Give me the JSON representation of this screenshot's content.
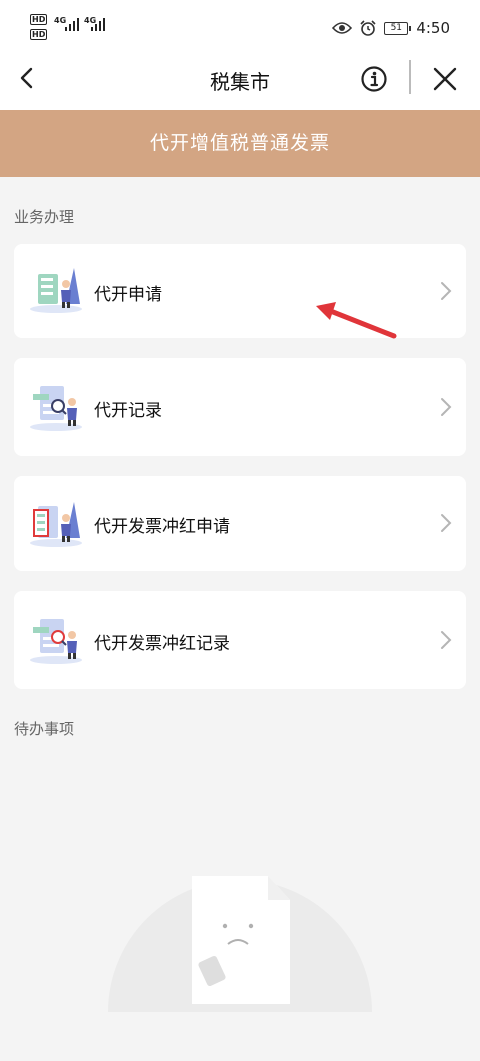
{
  "status_bar": {
    "left_indicators": [
      "HD",
      "HD",
      "4G",
      "4G"
    ],
    "battery": "51",
    "time": "4:50",
    "icons": [
      "eye-icon",
      "alarm-icon",
      "battery-icon"
    ]
  },
  "nav": {
    "title": "税集市",
    "icons": [
      "back-arrow-icon",
      "info-icon",
      "close-icon"
    ]
  },
  "banner": {
    "text": "代开增值税普通发票"
  },
  "business": {
    "section_title": "业务办理",
    "items": [
      {
        "label": "代开申请",
        "icon": "application-illustration-icon"
      },
      {
        "label": "代开记录",
        "icon": "records-illustration-icon"
      },
      {
        "label": "代开发票冲红申请",
        "icon": "red-invoice-application-illustration-icon"
      },
      {
        "label": "代开发票冲红记录",
        "icon": "red-invoice-records-illustration-icon"
      }
    ]
  },
  "todo": {
    "section_title": "待办事项",
    "empty_icon": "empty-document-icon"
  },
  "colors": {
    "banner_bg": "#d3a583",
    "page_bg": "#f4f4f4",
    "annotation_arrow": "#e0353a"
  }
}
